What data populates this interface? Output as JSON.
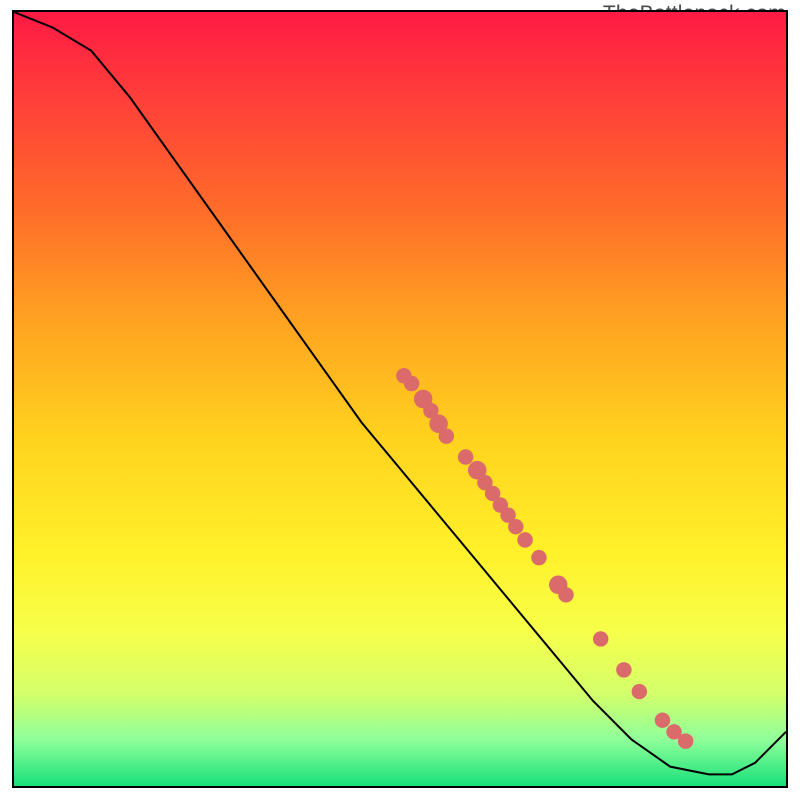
{
  "watermark": "TheBottleneck.com",
  "chart_data": {
    "type": "line",
    "title": "",
    "xlabel": "",
    "ylabel": "",
    "xlim": [
      0,
      100
    ],
    "ylim": [
      0,
      100
    ],
    "curve": [
      {
        "x": 0,
        "y": 100
      },
      {
        "x": 5,
        "y": 98
      },
      {
        "x": 10,
        "y": 95
      },
      {
        "x": 15,
        "y": 89
      },
      {
        "x": 20,
        "y": 82
      },
      {
        "x": 25,
        "y": 75
      },
      {
        "x": 30,
        "y": 68
      },
      {
        "x": 35,
        "y": 61
      },
      {
        "x": 40,
        "y": 54
      },
      {
        "x": 45,
        "y": 47
      },
      {
        "x": 50,
        "y": 41
      },
      {
        "x": 55,
        "y": 35
      },
      {
        "x": 60,
        "y": 29
      },
      {
        "x": 65,
        "y": 23
      },
      {
        "x": 70,
        "y": 17
      },
      {
        "x": 75,
        "y": 11
      },
      {
        "x": 80,
        "y": 6
      },
      {
        "x": 85,
        "y": 2.5
      },
      {
        "x": 90,
        "y": 1.5
      },
      {
        "x": 93,
        "y": 1.5
      },
      {
        "x": 96,
        "y": 3
      },
      {
        "x": 100,
        "y": 7
      }
    ],
    "markers": [
      {
        "x": 50.5,
        "y": 53,
        "r": 1.0
      },
      {
        "x": 51.5,
        "y": 52,
        "r": 1.0
      },
      {
        "x": 53.0,
        "y": 50,
        "r": 1.2
      },
      {
        "x": 54.0,
        "y": 48.5,
        "r": 1.0
      },
      {
        "x": 55.0,
        "y": 46.8,
        "r": 1.2
      },
      {
        "x": 56.0,
        "y": 45.2,
        "r": 1.0
      },
      {
        "x": 58.5,
        "y": 42.5,
        "r": 1.0
      },
      {
        "x": 60.0,
        "y": 40.8,
        "r": 1.2
      },
      {
        "x": 61.0,
        "y": 39.2,
        "r": 1.0
      },
      {
        "x": 62.0,
        "y": 37.8,
        "r": 1.0
      },
      {
        "x": 63.0,
        "y": 36.3,
        "r": 1.0
      },
      {
        "x": 64.0,
        "y": 35.0,
        "r": 1.0
      },
      {
        "x": 65.0,
        "y": 33.5,
        "r": 1.0
      },
      {
        "x": 66.2,
        "y": 31.8,
        "r": 1.0
      },
      {
        "x": 68.0,
        "y": 29.5,
        "r": 1.0
      },
      {
        "x": 70.5,
        "y": 26.0,
        "r": 1.2
      },
      {
        "x": 71.5,
        "y": 24.7,
        "r": 1.0
      },
      {
        "x": 76.0,
        "y": 19.0,
        "r": 1.0
      },
      {
        "x": 79.0,
        "y": 15.0,
        "r": 1.0
      },
      {
        "x": 81.0,
        "y": 12.2,
        "r": 1.0
      },
      {
        "x": 84.0,
        "y": 8.5,
        "r": 1.0
      },
      {
        "x": 85.5,
        "y": 7.0,
        "r": 1.0
      },
      {
        "x": 87.0,
        "y": 5.8,
        "r": 1.0
      }
    ],
    "marker_color": "#db6b6b",
    "curve_color": "#000000"
  }
}
